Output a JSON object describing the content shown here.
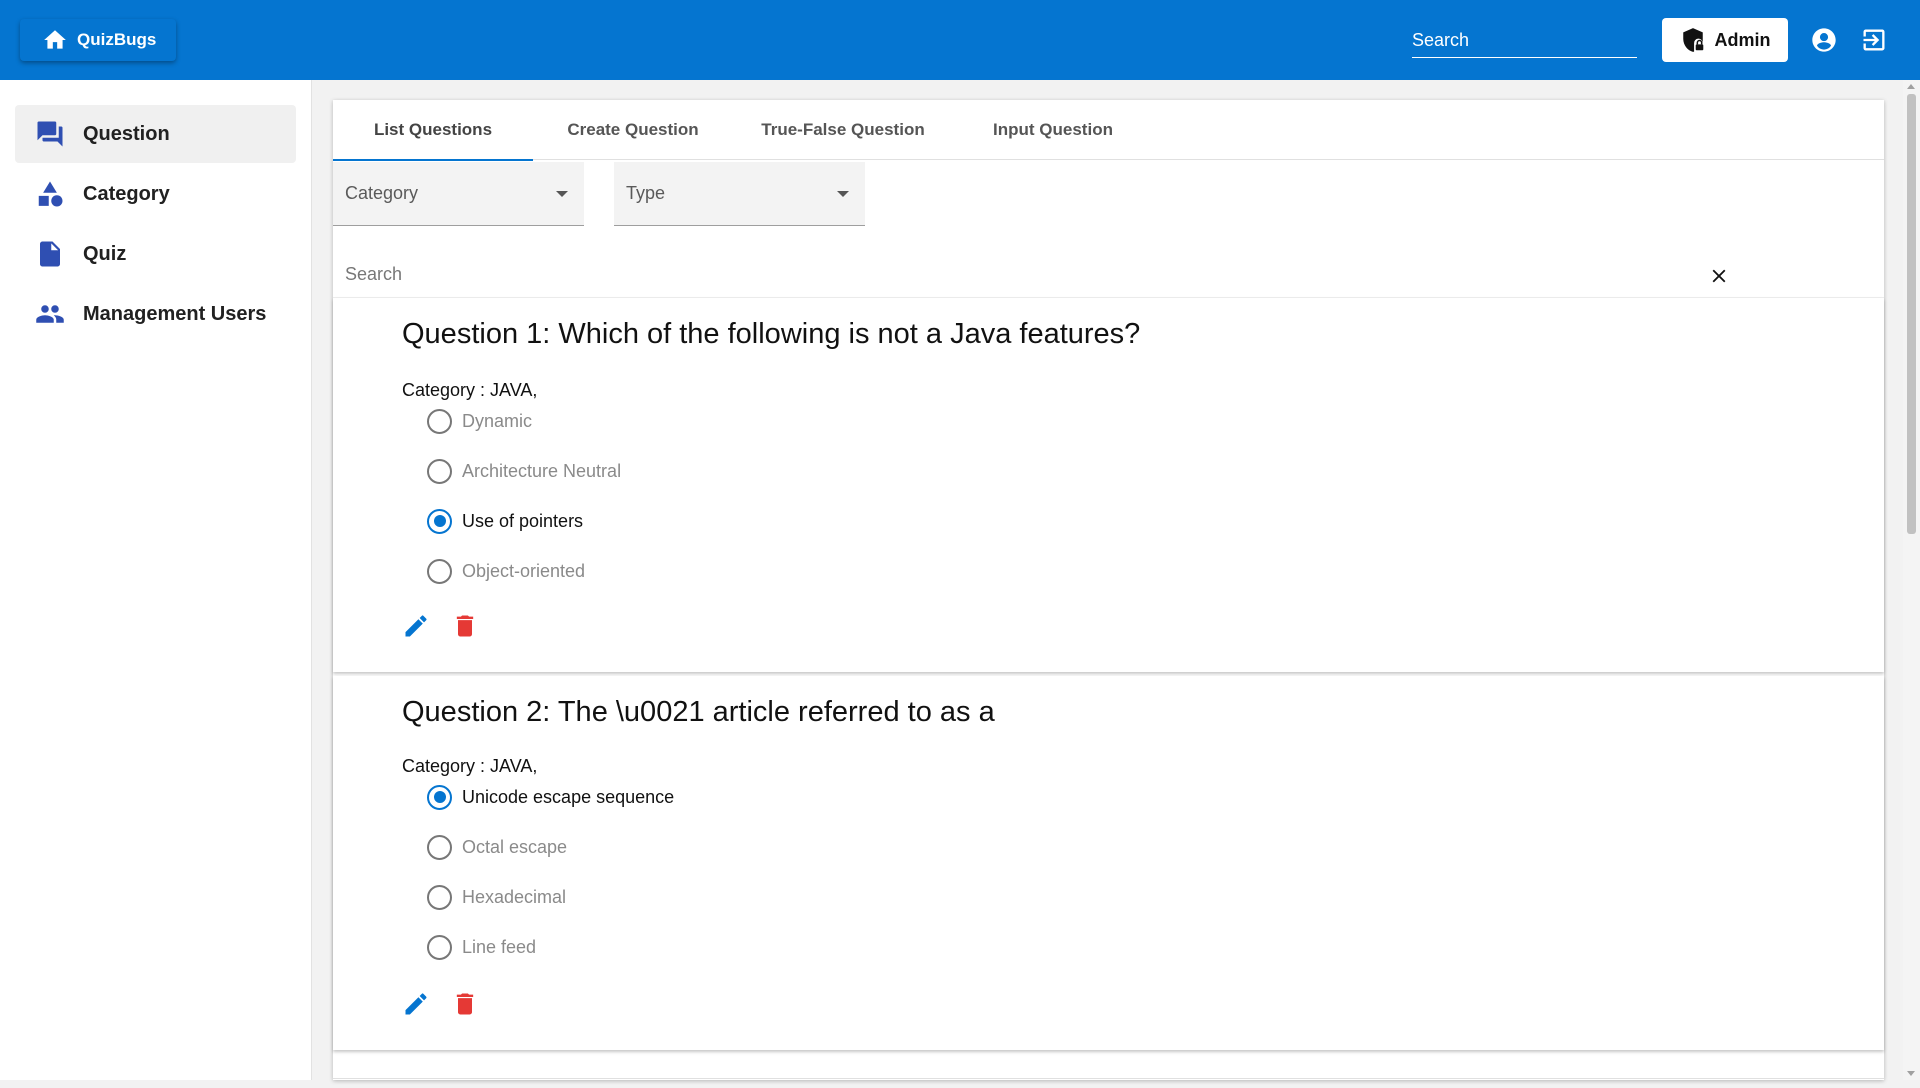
{
  "topbar": {
    "brand_label": "QuizBugs",
    "brand_icon": "home-icon",
    "search_placeholder": "Search",
    "admin_label": "Admin",
    "admin_icon": "shield-lock-icon",
    "account_icon": "account-circle-icon",
    "logout_icon": "logout-icon",
    "bar_color": "#0575d0"
  },
  "sidebar": {
    "items": [
      {
        "label": "Question",
        "icon": "forum-icon",
        "active": true
      },
      {
        "label": "Category",
        "icon": "shapes-icon",
        "active": false
      },
      {
        "label": "Quiz",
        "icon": "document-icon",
        "active": false
      },
      {
        "label": "Management Users",
        "icon": "users-icon",
        "active": false
      }
    ]
  },
  "tabs": [
    {
      "label": "List Questions",
      "active": true
    },
    {
      "label": "Create Question",
      "active": false
    },
    {
      "label": "True-False Question",
      "active": false
    },
    {
      "label": "Input Question",
      "active": false
    }
  ],
  "filters": {
    "category_label": "Category",
    "type_label": "Type",
    "search_placeholder": "Search"
  },
  "questions": [
    {
      "title": "Question 1: Which of the following is not a Java features?",
      "category": "Category : JAVA,",
      "options": [
        {
          "label": "Dynamic",
          "selected": false
        },
        {
          "label": "Architecture Neutral",
          "selected": false
        },
        {
          "label": "Use of pointers",
          "selected": true
        },
        {
          "label": "Object-oriented",
          "selected": false
        }
      ]
    },
    {
      "title": "Question 2: The \\u0021 article referred to as a",
      "category": "Category : JAVA,",
      "options": [
        {
          "label": "Unicode escape sequence",
          "selected": true
        },
        {
          "label": "Octal escape",
          "selected": false
        },
        {
          "label": "Hexadecimal",
          "selected": false
        },
        {
          "label": "Line feed",
          "selected": false
        }
      ]
    }
  ],
  "colors": {
    "accent": "#0575d0",
    "sidebar_icon": "#2f4fb2",
    "delete": "#e53935"
  }
}
